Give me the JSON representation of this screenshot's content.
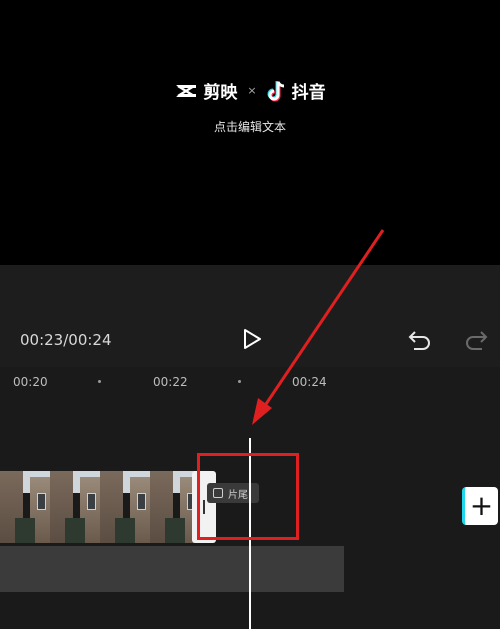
{
  "preview": {
    "brand_capcut": "剪映",
    "separator": "×",
    "brand_douyin": "抖音",
    "subtitle": "点击编辑文本"
  },
  "controls": {
    "time": "00:23/00:24",
    "play_icon": "play-icon",
    "undo_icon": "undo-icon",
    "redo_icon": "redo-icon"
  },
  "timeline": {
    "ruler": [
      "00:20",
      "00:22",
      "00:24"
    ],
    "ending_label": "片尾",
    "add_label": "+"
  },
  "colors": {
    "background": "#000000",
    "panel": "#1d1d1d",
    "timeline": "#1a1a1a",
    "annotation": "#e02020",
    "accent_cyan": "#20d5ec",
    "accent_pink": "#fe2c55"
  }
}
